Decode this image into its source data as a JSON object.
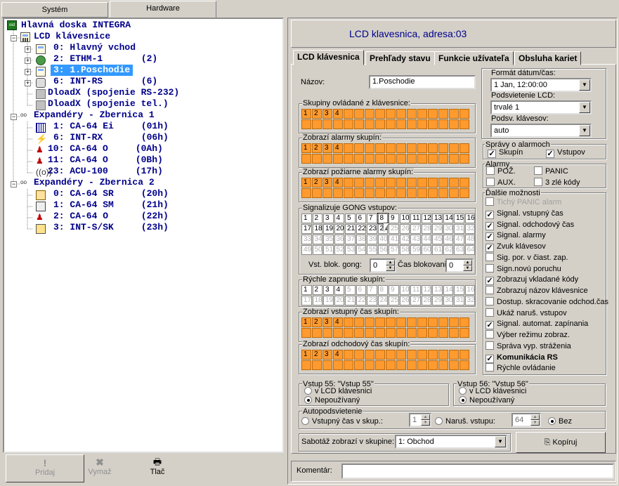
{
  "tabs_top": [
    "Systém",
    "Hardware"
  ],
  "tree": [
    {
      "label": "Hlavná doska INTEGRA"
    },
    {
      "label": "LCD klávesnice"
    },
    {
      "label": "0: Hlavný vchod"
    },
    {
      "label": "2: ETHM-1       (2)"
    },
    {
      "label": "3: 1.Poschodie"
    },
    {
      "label": "6: INT-RS       (6)"
    },
    {
      "label": "DloadX (spojenie RS-232)"
    },
    {
      "label": "DloadX (spojenie tel.)"
    },
    {
      "label": "Expandéry - Zbernica 1"
    },
    {
      "label": "1: CA-64 Ei     (01h)"
    },
    {
      "label": "6: INT-RX       (06h)"
    },
    {
      "label": "10: CA-64 O     (0Ah)"
    },
    {
      "label": "11: CA-64 O     (0Bh)"
    },
    {
      "label": "23: ACU-100     (17h)"
    },
    {
      "label": "Expandéry - Zbernica 2"
    },
    {
      "label": "0: CA-64 SR     (20h)"
    },
    {
      "label": "1: CA-64 SM     (21h)"
    },
    {
      "label": "2: CA-64 O      (22h)"
    },
    {
      "label": "3: INT-S/SK     (23h)"
    }
  ],
  "bottom_buttons": {
    "add": "Pridaj",
    "delete": "Vymaž",
    "print": "Tlač"
  },
  "header_title": "LCD klavesnica, adresa:03",
  "inner_tabs": [
    "LCD klávesnica",
    "Prehľady stavu",
    "Funkcie užívateľa",
    "Obsluha kariet"
  ],
  "name_label": "Názov:",
  "name_value": "1.Poschodie",
  "groups": {
    "controlled": "Skupiny ovládané z klávesnice:",
    "alarms": "Zobrazí alarmy skupín:",
    "fire": "Zobrazí požiarne alarmy skupín:",
    "gong": "Signalizuje GONG vstupov:",
    "quick": "Rýchle zapnutie skupín:",
    "entry": "Zobrazí vstupný čas skupín:",
    "exit": "Zobrazí odchodový čas skupín:"
  },
  "orange_active": [
    "1",
    "2",
    "3",
    "4"
  ],
  "gong_active_max": 24,
  "gong_block_label": "Vst. blok. gong:",
  "gong_block_value": "0",
  "block_time_label": "Čas blokovania",
  "block_time_value": "0",
  "quick_active_max": 4,
  "date_format_label": "Formát dátum/čas:",
  "date_format_value": "1 Jan, 12:00:00",
  "lcd_backlight_label": "Podsvietenie LCD:",
  "lcd_backlight_value": "trvalé 1",
  "key_backlight_label": "Podsv. klávesov:",
  "key_backlight_value": "auto",
  "alarm_msgs": {
    "title": "Správy o alarmoch",
    "groups": "Skupín",
    "inputs": "Vstupov"
  },
  "alarms_box": {
    "title": "Alarmy",
    "poz": "POŽ.",
    "panic": "PANIC",
    "aux": "AUX.",
    "wrong": "3 zlé kódy"
  },
  "options_title": "Ďalšie možnosti",
  "options": [
    {
      "label": "Tichý PANIC alarm",
      "checked": false,
      "disabled": true
    },
    {
      "label": "Signal. vstupný čas",
      "checked": true
    },
    {
      "label": "Signal. odchodový čas",
      "checked": true
    },
    {
      "label": "Signal. alarmy",
      "checked": true
    },
    {
      "label": "Zvuk klávesov",
      "checked": true
    },
    {
      "label": "Sig. por. v čiast. zap.",
      "checked": false
    },
    {
      "label": "Sign.novú poruchu",
      "checked": false
    },
    {
      "label": "Zobrazuj vkladané kódy",
      "checked": true
    },
    {
      "label": "Zobrazuj názov klávesnice",
      "checked": false
    },
    {
      "label": "Dostup. skracovanie odchod.čas",
      "checked": false
    },
    {
      "label": "Ukáž naruš. vstupov",
      "checked": false
    },
    {
      "label": "Signal. automat. zapínania",
      "checked": true
    },
    {
      "label": "Výber režimu zobraz.",
      "checked": false
    },
    {
      "label": "Správa vyp. stráženia",
      "checked": false
    },
    {
      "label": "Komunikácia RS",
      "checked": true,
      "bold": true
    },
    {
      "label": "Rýchle ovládanie",
      "checked": false
    }
  ],
  "input55": {
    "title": "Vstup 55: \"Vstup  55\"",
    "opt1": "v LCD klávesnici",
    "opt2": "Nepoužívaný"
  },
  "input56": {
    "title": "Vstup 56: \"Vstup  56\"",
    "opt1": "v LCD klávesnici",
    "opt2": "Nepoužívaný"
  },
  "autobacklight": {
    "title": "Autopodsvietenie",
    "entry": "Vstupný čas v skup.:",
    "entry_val": "1",
    "breach": "Naruš. vstupu:",
    "breach_val": "64",
    "none": "Bez"
  },
  "sabotage_label": "Sabotáž zobrazí v skupine:",
  "sabotage_value": "1: Obchod",
  "copy_btn": "Kopíruj",
  "comment_label": "Komentár:",
  "comment_value": ""
}
